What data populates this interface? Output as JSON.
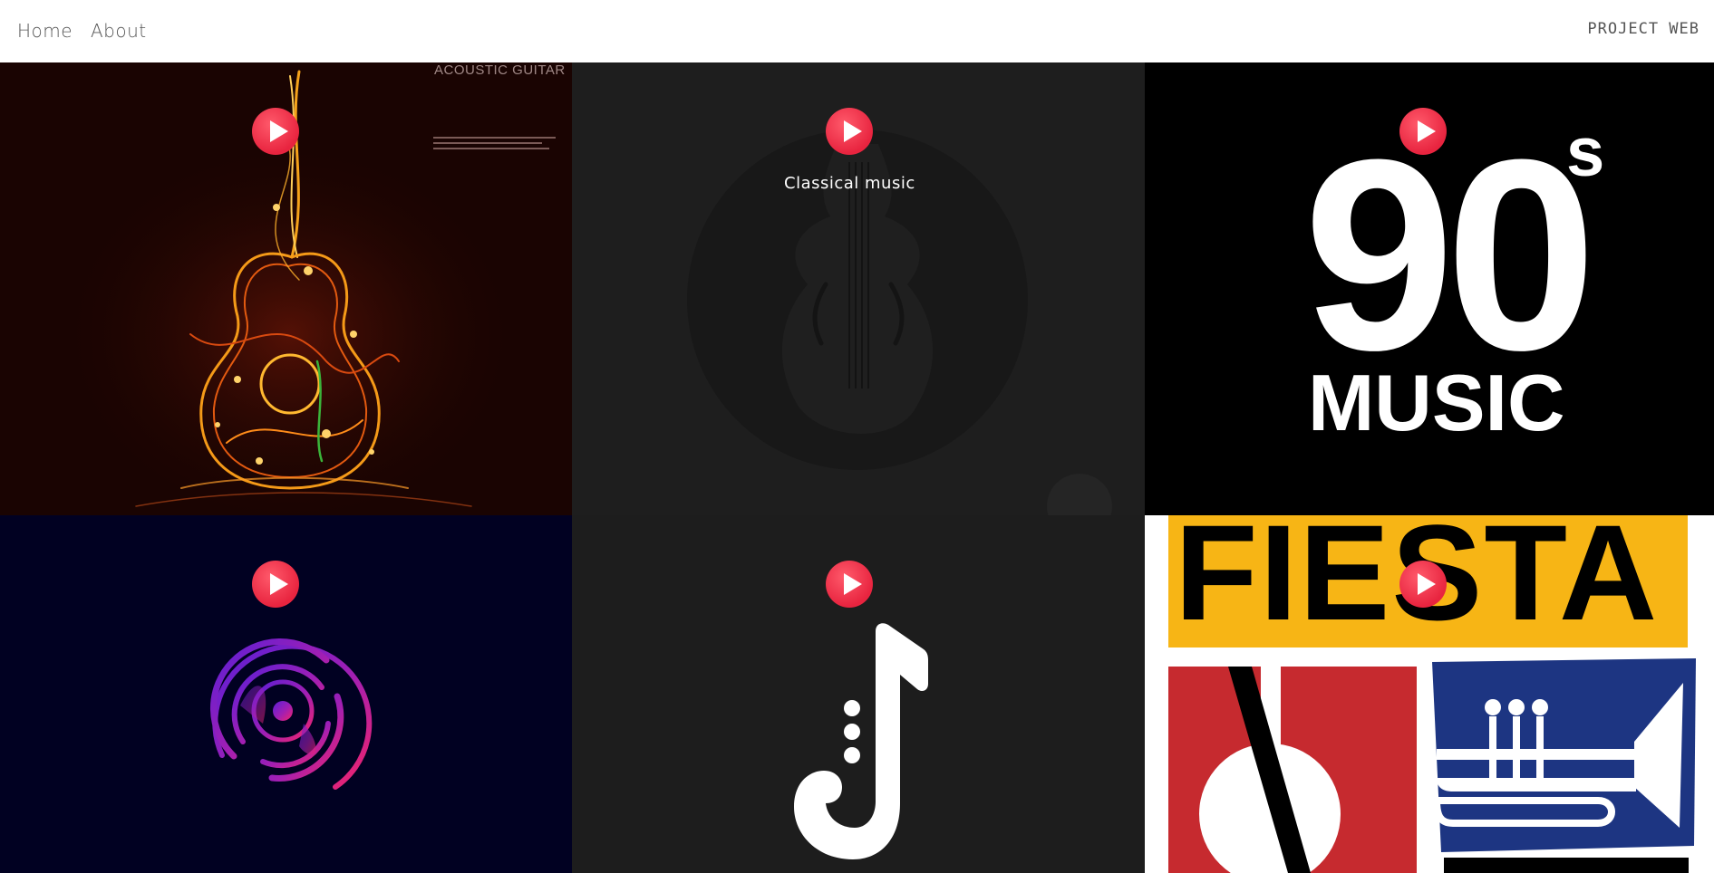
{
  "nav": {
    "home_label": "Home",
    "about_label": "About",
    "brand": "PROJECT WEB"
  },
  "tiles": [
    {
      "name": "acoustic",
      "tag": "ACOUSTIC GUITAR",
      "play_icon": "play-icon"
    },
    {
      "name": "classical",
      "caption": "Classical music",
      "play_icon": "play-icon"
    },
    {
      "name": "nineties",
      "big": "90",
      "sup": "s",
      "word": "MUSIC",
      "play_icon": "play-icon"
    },
    {
      "name": "vinyl",
      "icon": "vinyl-disc-icon",
      "play_icon": "play-icon"
    },
    {
      "name": "saxophone",
      "icon": "saxophone-note-icon",
      "play_icon": "play-icon"
    },
    {
      "name": "fiesta",
      "word": "FIESTA",
      "play_icon": "play-icon"
    }
  ],
  "colors": {
    "accent_red": "#e8243f",
    "fiesta_yellow": "#f7b515",
    "fiesta_red": "#c62a2f",
    "fiesta_blue": "#1d3582"
  }
}
